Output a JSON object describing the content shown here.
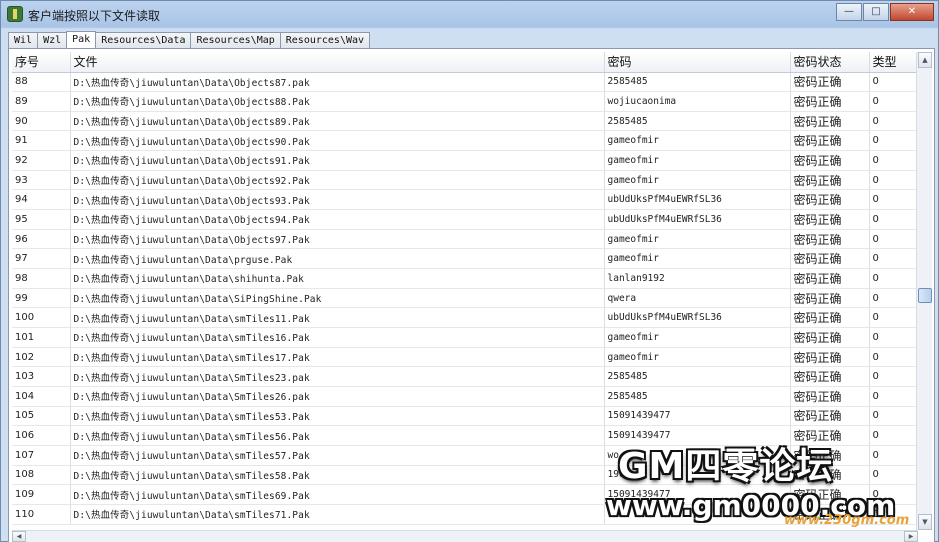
{
  "window": {
    "title": "客户端按照以下文件读取",
    "minimize_glyph": "—",
    "maximize_glyph": "□",
    "close_glyph": "✕"
  },
  "tabs": [
    {
      "label": "Wil"
    },
    {
      "label": "Wzl"
    },
    {
      "label": "Pak",
      "active": true
    },
    {
      "label": "Resources\\Data"
    },
    {
      "label": "Resources\\Map"
    },
    {
      "label": "Resources\\Wav"
    }
  ],
  "table": {
    "columns": [
      "序号",
      "文件",
      "密码",
      "密码状态",
      "类型"
    ],
    "rows": [
      [
        "88",
        "D:\\热血传奇\\jiuwuluntan\\Data\\Objects87.pak",
        "2585485",
        "密码正确",
        "0"
      ],
      [
        "89",
        "D:\\热血传奇\\jiuwuluntan\\Data\\Objects88.Pak",
        "wojiucaonima",
        "密码正确",
        "0"
      ],
      [
        "90",
        "D:\\热血传奇\\jiuwuluntan\\Data\\Objects89.Pak",
        "2585485",
        "密码正确",
        "0"
      ],
      [
        "91",
        "D:\\热血传奇\\jiuwuluntan\\Data\\Objects90.Pak",
        "gameofmir",
        "密码正确",
        "0"
      ],
      [
        "92",
        "D:\\热血传奇\\jiuwuluntan\\Data\\Objects91.Pak",
        "gameofmir",
        "密码正确",
        "0"
      ],
      [
        "93",
        "D:\\热血传奇\\jiuwuluntan\\Data\\Objects92.Pak",
        "gameofmir",
        "密码正确",
        "0"
      ],
      [
        "94",
        "D:\\热血传奇\\jiuwuluntan\\Data\\Objects93.Pak",
        "ubUdUksPfM4uEWRfSL36",
        "密码正确",
        "0"
      ],
      [
        "95",
        "D:\\热血传奇\\jiuwuluntan\\Data\\Objects94.Pak",
        "ubUdUksPfM4uEWRfSL36",
        "密码正确",
        "0"
      ],
      [
        "96",
        "D:\\热血传奇\\jiuwuluntan\\Data\\Objects97.Pak",
        "gameofmir",
        "密码正确",
        "0"
      ],
      [
        "97",
        "D:\\热血传奇\\jiuwuluntan\\Data\\prguse.Pak",
        "gameofmir",
        "密码正确",
        "0"
      ],
      [
        "98",
        "D:\\热血传奇\\jiuwuluntan\\Data\\shihunta.Pak",
        "lanlan9192",
        "密码正确",
        "0"
      ],
      [
        "99",
        "D:\\热血传奇\\jiuwuluntan\\Data\\SiPingShine.Pak",
        "qwera",
        "密码正确",
        "0"
      ],
      [
        "100",
        "D:\\热血传奇\\jiuwuluntan\\Data\\smTiles11.Pak",
        "ubUdUksPfM4uEWRfSL36",
        "密码正确",
        "0"
      ],
      [
        "101",
        "D:\\热血传奇\\jiuwuluntan\\Data\\smTiles16.Pak",
        "gameofmir",
        "密码正确",
        "0"
      ],
      [
        "102",
        "D:\\热血传奇\\jiuwuluntan\\Data\\smTiles17.Pak",
        "gameofmir",
        "密码正确",
        "0"
      ],
      [
        "103",
        "D:\\热血传奇\\jiuwuluntan\\Data\\SmTiles23.pak",
        "2585485",
        "密码正确",
        "0"
      ],
      [
        "104",
        "D:\\热血传奇\\jiuwuluntan\\Data\\SmTiles26.pak",
        "2585485",
        "密码正确",
        "0"
      ],
      [
        "105",
        "D:\\热血传奇\\jiuwuluntan\\Data\\smTiles53.Pak",
        "15091439477",
        "密码正确",
        "0"
      ],
      [
        "106",
        "D:\\热血传奇\\jiuwuluntan\\Data\\smTiles56.Pak",
        "15091439477",
        "密码正确",
        "0"
      ],
      [
        "107",
        "D:\\热血传奇\\jiuwuluntan\\Data\\smTiles57.Pak",
        "wo",
        "密码正确",
        "0"
      ],
      [
        "108",
        "D:\\热血传奇\\jiuwuluntan\\Data\\smTiles58.Pak",
        "190",
        "密码正确",
        "0"
      ],
      [
        "109",
        "D:\\热血传奇\\jiuwuluntan\\Data\\smTiles69.Pak",
        "15091439477",
        "密码正确",
        "0"
      ],
      [
        "110",
        "D:\\热血传奇\\jiuwuluntan\\Data\\smTiles71.Pak",
        "",
        "密码正确",
        "0"
      ]
    ]
  },
  "scrollbar": {
    "up": "▲",
    "down": "▼",
    "left": "◀",
    "right": "▶"
  },
  "watermark": {
    "line1": "GM四零论坛",
    "line2": "www.gm0000.com",
    "line3": "www.230gm.com"
  }
}
